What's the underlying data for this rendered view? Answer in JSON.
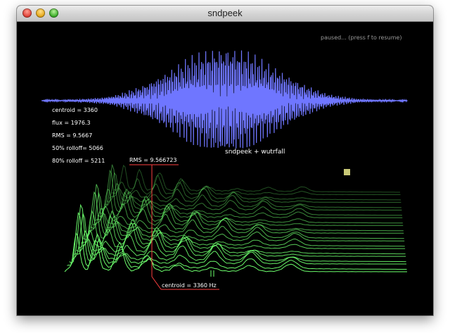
{
  "window": {
    "title": "sndpeek"
  },
  "status": {
    "paused_message": "paused... (press f to resume)"
  },
  "overlay_title": "sndpeek + wutrfall",
  "features": {
    "centroid": "centroid = 3360",
    "flux": "flux = 1976.3",
    "rms": "RMS = 9.5667",
    "rolloff50": "50% rolloff= 5066",
    "rolloff80": "80% rolloff = 5211"
  },
  "rms_marker": "RMS = 9.566723",
  "centroid_marker": "centroid = 3360 Hz",
  "colors": {
    "waveform": "#6f76ff",
    "spectrum": "#6dff6d",
    "text": "#ffffff",
    "status_text": "#9a9a9a",
    "marker": "#ff4040",
    "indicator": "#c9c977"
  }
}
